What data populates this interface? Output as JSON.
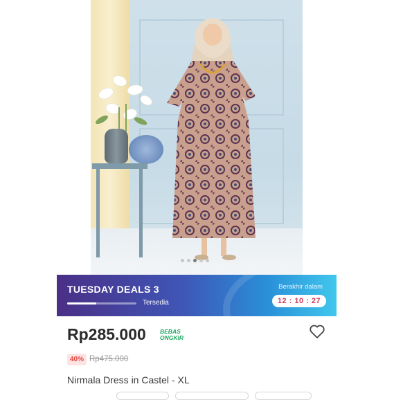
{
  "gallery": {
    "image_alt": "Nirmala Dress in Castel",
    "dots_total": 5,
    "active_dot": 3
  },
  "flash_sale": {
    "title": "TUESDAY DEALS 3",
    "stock_label": "Tersedia",
    "stock_fraction": 0.42,
    "ends_label": "Berakhir dalam",
    "countdown": "12 : 10 : 27"
  },
  "product": {
    "price": "Rp285.000",
    "free_shipping_line1": "BEBAS",
    "free_shipping_line2": "ONGKIR",
    "discount_badge": "40%",
    "original_price": "Rp475.000",
    "name": "Nirmala Dress in Castel - XL"
  },
  "colors": {
    "price": "#2b2b2b",
    "free_shipping": "#1ea760",
    "discount": "#e0453f",
    "countdown": "#d23a5a"
  }
}
